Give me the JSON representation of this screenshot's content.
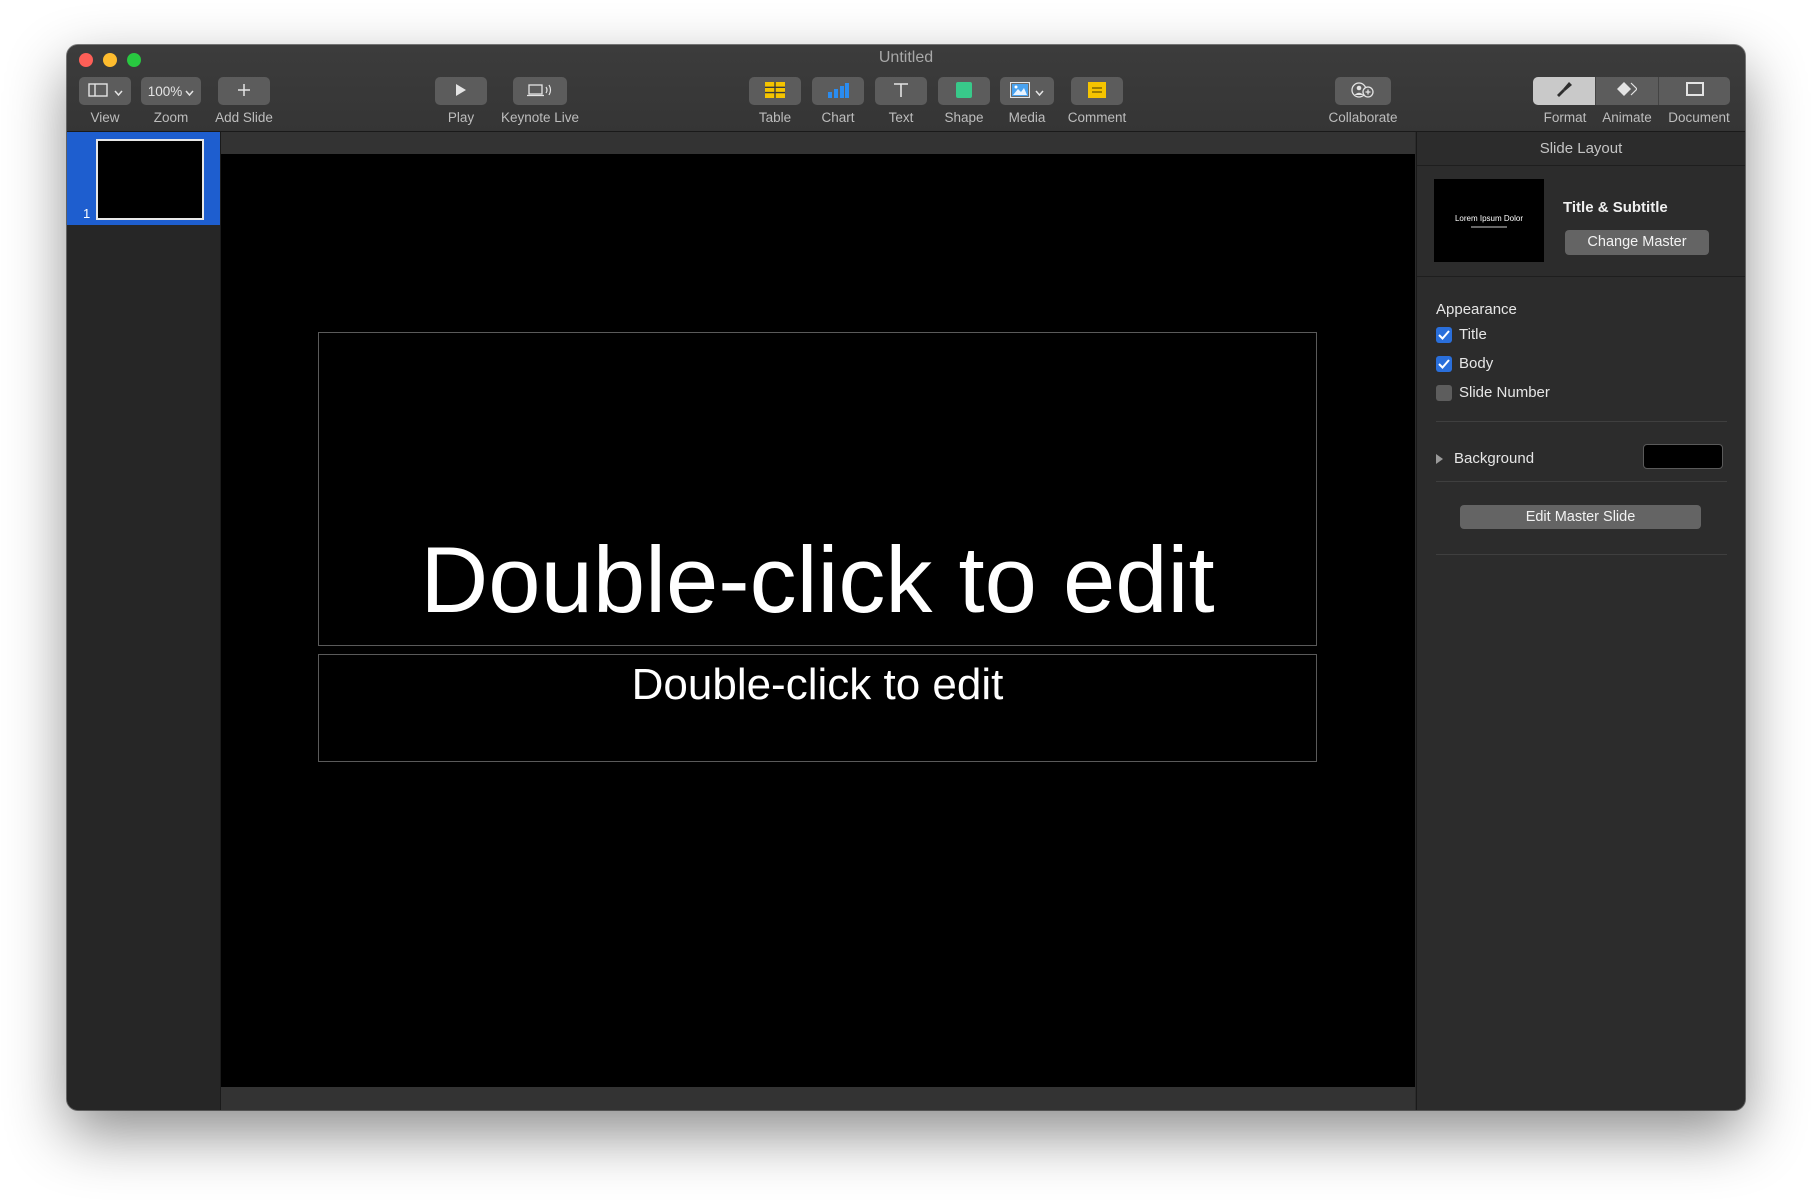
{
  "window": {
    "title": "Untitled"
  },
  "toolbar": {
    "view_label": "View",
    "zoom_value": "100%",
    "zoom_label": "Zoom",
    "add_slide_label": "Add Slide",
    "play_label": "Play",
    "keynote_live_label": "Keynote Live",
    "table_label": "Table",
    "chart_label": "Chart",
    "text_label": "Text",
    "shape_label": "Shape",
    "media_label": "Media",
    "comment_label": "Comment",
    "collaborate_label": "Collaborate",
    "format_label": "Format",
    "animate_label": "Animate",
    "document_label": "Document",
    "active_inspector_tab": "Format"
  },
  "navigator": {
    "slides": [
      {
        "number": "1",
        "selected": true
      }
    ]
  },
  "slide": {
    "title_placeholder": "Double-click to edit",
    "subtitle_placeholder": "Double-click to edit",
    "background_color": "#000000"
  },
  "inspector": {
    "header": "Slide Layout",
    "master_name": "Title & Subtitle",
    "master_thumb_title": "Lorem Ipsum Dolor",
    "change_master_label": "Change Master",
    "appearance_title": "Appearance",
    "appearance_options": [
      {
        "label": "Title",
        "checked": true
      },
      {
        "label": "Body",
        "checked": true
      },
      {
        "label": "Slide Number",
        "checked": false
      }
    ],
    "background_label": "Background",
    "background_swatch_color": "#000000",
    "edit_master_label": "Edit Master Slide"
  },
  "colors": {
    "selection_blue": "#1e5ecf",
    "checkbox_blue": "#2a6fdb",
    "table_icon": "#f5c400",
    "chart_icon": "#2a8cf0",
    "shape_icon": "#38c98a",
    "media_icon": "#4aa3f0",
    "comment_icon": "#f5c400"
  }
}
